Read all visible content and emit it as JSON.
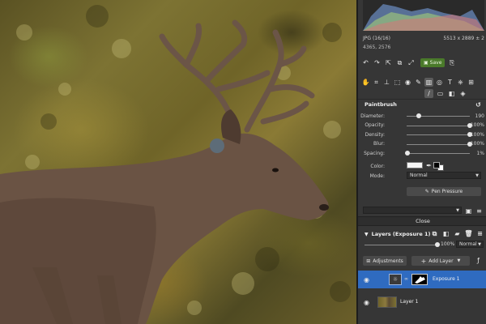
{
  "file_info": {
    "format": "JPG (16/16)",
    "dimensions": "5513 x 2889 ± 2",
    "coords": "4365, 2576"
  },
  "toolbar": {
    "save_label": "Save",
    "icons": [
      "undo-icon",
      "redo-icon",
      "export-icon",
      "compare-icon",
      "save-icon"
    ]
  },
  "tools": {
    "row1": [
      "hand-icon",
      "crop-icon",
      "straighten-icon",
      "transform-icon",
      "view-icon",
      "brush-adjust-icon",
      "gradient-icon",
      "radial-icon",
      "text-icon",
      "clone-icon",
      "grid-icon"
    ],
    "row2": [
      "paintbrush-icon",
      "eraser-icon",
      "fill-icon",
      "mask-icon"
    ],
    "selected": "paintbrush-icon"
  },
  "paintbrush": {
    "title": "Paintbrush",
    "sliders": [
      {
        "label": "Diameter:",
        "value_text": "190",
        "fraction": 0.19
      },
      {
        "label": "Opacity:",
        "value_text": "100%",
        "fraction": 1.0
      },
      {
        "label": "Density:",
        "value_text": "100%",
        "fraction": 1.0
      },
      {
        "label": "Blur:",
        "value_text": "100%",
        "fraction": 1.0
      },
      {
        "label": "Spacing:",
        "value_text": "1%",
        "fraction": 0.01
      }
    ],
    "color_label": "Color:",
    "mode_label": "Mode:",
    "mode_value": "Normal",
    "pen_pressure_label": "Pen Pressure"
  },
  "close_label": "Close",
  "layers": {
    "title": "Layers (Exposure 1)",
    "opacity_text": "100%",
    "opacity_fraction": 1.0,
    "blend_mode": "Normal",
    "adjustments_label": "Adjustments",
    "add_layer_label": "Add Layer",
    "items": [
      {
        "name": "Exposure 1",
        "active": true
      },
      {
        "name": "Layer 1",
        "active": false
      }
    ]
  }
}
